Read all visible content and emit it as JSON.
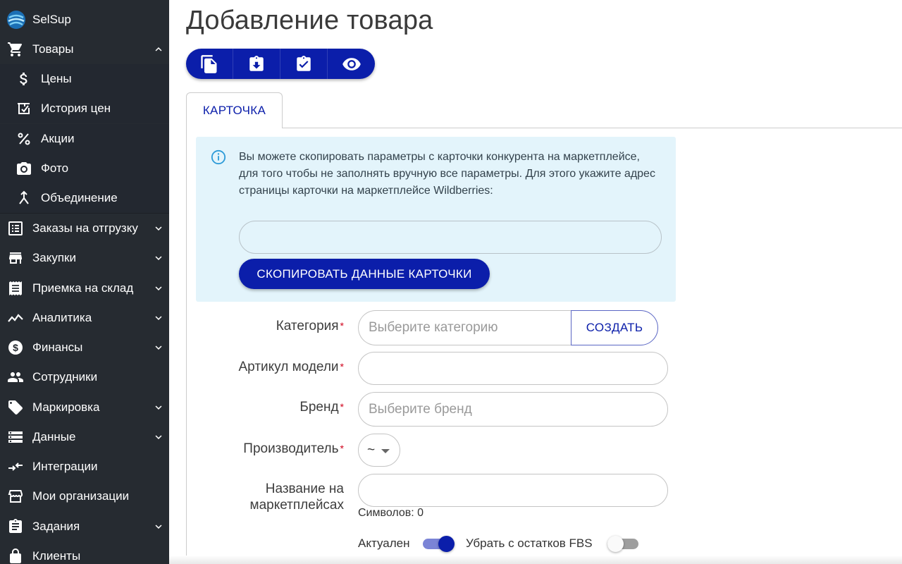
{
  "app": {
    "name": "SelSup"
  },
  "sidebar": {
    "items": [
      {
        "label": "Товары",
        "icon": "cart-icon",
        "expanded": true
      },
      {
        "label": "Цены",
        "icon": "dollar-icon",
        "sub": true
      },
      {
        "label": "История цен",
        "icon": "price-history-icon",
        "sub": true
      },
      {
        "label": "Акции",
        "icon": "percent-icon",
        "sub": true
      },
      {
        "label": "Фото",
        "icon": "camera-icon",
        "sub": true
      },
      {
        "label": "Объединение",
        "icon": "merge-icon",
        "sub": true
      },
      {
        "label": "Заказы на отгрузку",
        "icon": "list-icon",
        "expandable": true
      },
      {
        "label": "Закупки",
        "icon": "store-icon",
        "expandable": true
      },
      {
        "label": "Приемка на склад",
        "icon": "receipt-icon",
        "expandable": true
      },
      {
        "label": "Аналитика",
        "icon": "analytics-icon",
        "expandable": true
      },
      {
        "label": "Финансы",
        "icon": "money-icon",
        "expandable": true
      },
      {
        "label": "Сотрудники",
        "icon": "people-icon"
      },
      {
        "label": "Маркировка",
        "icon": "tag-icon",
        "expandable": true
      },
      {
        "label": "Данные",
        "icon": "storage-icon",
        "expandable": true
      },
      {
        "label": "Интеграции",
        "icon": "integration-icon"
      },
      {
        "label": "Мои организации",
        "icon": "organization-icon"
      },
      {
        "label": "Задания",
        "icon": "clipboard-icon",
        "expandable": true
      },
      {
        "label": "Клиенты",
        "icon": "lock-icon"
      }
    ]
  },
  "page": {
    "title": "Добавление товара"
  },
  "toolbar": {
    "buttons": [
      "copy-icon",
      "download-icon",
      "checklist-icon",
      "eye-icon"
    ]
  },
  "tabs": {
    "active": "КАРТОЧКА"
  },
  "info": {
    "text": "Вы можете скопировать параметры с карточки конкурента на маркетплейсе, для того чтобы не заполнять вручную все параметры. Для этого укажите адрес страницы карточки на маркетплейсе Wildberries:",
    "url_value": "",
    "copy_button": "СКОПИРОВАТЬ ДАННЫЕ КАРТОЧКИ"
  },
  "form": {
    "category": {
      "label": "Категория",
      "placeholder": "Выберите категорию",
      "create_button": "СОЗДАТЬ"
    },
    "article": {
      "label": "Артикул модели",
      "value": ""
    },
    "brand": {
      "label": "Бренд",
      "placeholder": "Выберите бренд"
    },
    "manufacturer": {
      "label": "Производитель",
      "value": "~"
    },
    "marketplace_name": {
      "label_line1": "Название на",
      "label_line2": "маркетплейсах",
      "value": "",
      "counter": "Символов: 0"
    },
    "required_mark": "*",
    "toggles": [
      {
        "label": "Актуален",
        "on": true
      },
      {
        "label": "Убрать с остатков FBS",
        "on": false
      }
    ]
  },
  "colors": {
    "sidebar_bg": "#262b31",
    "accent": "#0b1eaa",
    "info_bg": "#e3f4fb",
    "required": "#d0021b"
  }
}
